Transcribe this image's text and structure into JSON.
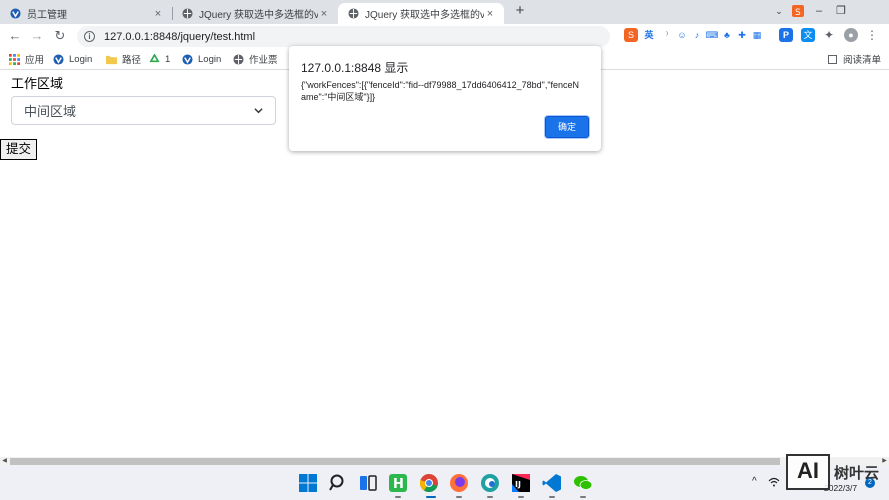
{
  "tabs": [
    {
      "title": "员工管理",
      "active": false
    },
    {
      "title": "JQuery 获取选中多选框的value",
      "active": false
    },
    {
      "title": "JQuery 获取选中多选框的value",
      "active": true
    }
  ],
  "tab_close_glyph": "×",
  "new_tab_glyph": "+",
  "window_controls": {
    "minimize": "–",
    "restore": "❐"
  },
  "address": {
    "url": "127.0.0.1:8848/jquery/test.html",
    "info_glyph": "i"
  },
  "nav": {
    "back": "←",
    "forward": "→",
    "reload": "↻",
    "bookmark_star": "☆"
  },
  "extensions_ime": {
    "sogou_label": "英"
  },
  "bookmarks": [
    {
      "label": "应用",
      "icon": "apps-grid-icon"
    },
    {
      "label": "Login",
      "icon": "vue-icon"
    },
    {
      "label": "路径",
      "icon": "folder-icon"
    },
    {
      "label": "1",
      "icon": "recycle-icon"
    },
    {
      "label": "Login",
      "icon": "vue-icon"
    },
    {
      "label": "作业票",
      "icon": "globe-icon"
    }
  ],
  "reading_list": "阅读清单",
  "page": {
    "label": "工作区域",
    "select_value": "中间区域",
    "submit_label": "提交"
  },
  "dialog": {
    "title": "127.0.0.1:8848 显示",
    "message": "{\"workFences\":[{\"fenceId\":\"fid--df79988_17dd6406412_78bd\",\"fenceName\":\"中间区域\"}]}",
    "ok_label": "确定"
  },
  "taskbar": {
    "apps": [
      "windows-start-icon",
      "search-icon",
      "task-view-icon",
      "hbuilder-icon",
      "chrome-icon",
      "firefox-icon",
      "edge-dev-icon",
      "intellij-icon",
      "vscode-icon",
      "wechat-icon"
    ],
    "tray_chevron": "^",
    "date": "2022/3/7",
    "notification_count": "2"
  },
  "watermark": {
    "box": "AI",
    "text": "树叶云"
  },
  "colors": {
    "accent": "#1a73e8",
    "tabstrip": "#dee1e6",
    "taskbar": "#eef0f5"
  }
}
